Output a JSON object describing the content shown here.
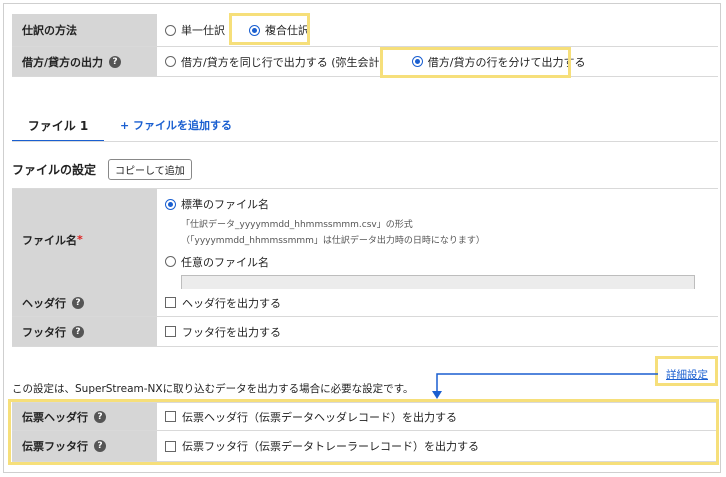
{
  "journal": {
    "method_label": "仕訳の方法",
    "single_label": "単一仕訳",
    "compound_label": "複合仕訳",
    "output_label": "借方/貸方の出力",
    "same_row_label": "借方/貸方を同じ行で出力する (弥生会計)",
    "separate_rows_label": "借方/貸方の行を分けて出力する"
  },
  "tabs": {
    "file1_label": "ファイル 1",
    "add_file_label": "+ ファイルを追加する"
  },
  "file_settings": {
    "title": "ファイルの設定",
    "copy_add_label": "コピーして追加",
    "filename_label": "ファイル名",
    "required_mark": "*",
    "standard_label": "標準のファイル名",
    "standard_format": "「仕訳データ_yyyymmdd_hhmmssmmm.csv」の形式",
    "standard_note": "（「yyyymmdd_hhmmssmmm」は仕訳データ出力時の日時になります）",
    "custom_label": "任意のファイル名",
    "custom_value": "",
    "header_row_label": "ヘッダ行",
    "header_row_option": "ヘッダ行を出力する",
    "footer_row_label": "フッタ行",
    "footer_row_option": "フッタ行を出力する"
  },
  "note": "この設定は、SuperStream-NXに取り込むデータを出力する場合に必要な設定です。",
  "detail_link": "詳細設定",
  "slip": {
    "header_label": "伝票ヘッダ行",
    "header_option": "伝票ヘッダ行（伝票データヘッダレコード）を出力する",
    "footer_label": "伝票フッタ行",
    "footer_option": "伝票フッタ行（伝票データトレーラーレコード）を出力する"
  },
  "colors": {
    "accent": "#1a5fd0",
    "highlight": "#f6df7a",
    "header_bg": "#d6d6d6"
  }
}
